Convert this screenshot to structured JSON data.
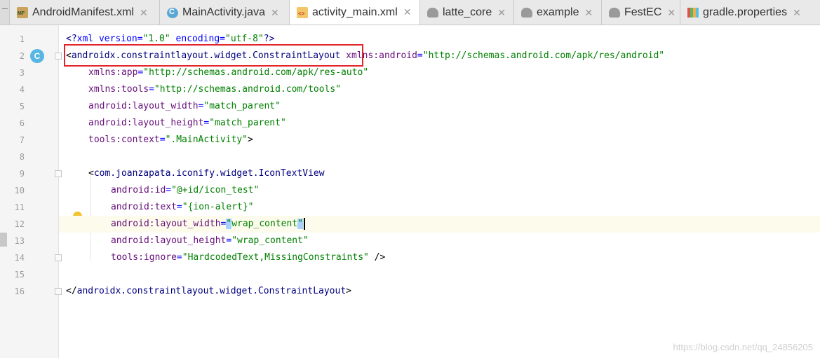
{
  "tabs": [
    {
      "label": "AndroidManifest.xml",
      "icon": "manifest-file-icon",
      "active": false
    },
    {
      "label": "MainActivity.java",
      "icon": "java-class-icon",
      "active": false
    },
    {
      "label": "activity_main.xml",
      "icon": "xml-layout-icon",
      "active": true
    },
    {
      "label": "latte_core",
      "icon": "gradle-module-icon",
      "active": false
    },
    {
      "label": "example",
      "icon": "gradle-module-icon",
      "active": false
    },
    {
      "label": "FestEC",
      "icon": "gradle-module-icon",
      "active": false
    },
    {
      "label": "gradle.properties",
      "icon": "properties-file-icon",
      "active": false
    }
  ],
  "close_glyph": "✕",
  "gutter": {
    "line_numbers": [
      "1",
      "2",
      "3",
      "4",
      "5",
      "6",
      "7",
      "8",
      "9",
      "10",
      "11",
      "12",
      "13",
      "14",
      "15",
      "16"
    ],
    "class_badge": "C"
  },
  "code": {
    "l1": [
      "<?",
      "xml version=",
      "\"1.0\"",
      " encoding=",
      "\"utf-8\"",
      "?>"
    ],
    "l2": [
      "<",
      "androidx.constraintlayout.widget.ConstraintLayout",
      " ",
      "xmlns:android",
      "=",
      "\"http://schemas.android.com/apk/res/android\""
    ],
    "l3": [
      "xmlns:app",
      "=",
      "\"http://schemas.android.com/apk/res-auto\""
    ],
    "l4": [
      "xmlns:tools",
      "=",
      "\"http://schemas.android.com/tools\""
    ],
    "l5": [
      "android:layout_width",
      "=",
      "\"match_parent\""
    ],
    "l6": [
      "android:layout_height",
      "=",
      "\"match_parent\""
    ],
    "l7": [
      "tools:context",
      "=",
      "\".MainActivity\"",
      ">"
    ],
    "l9": [
      "<",
      "com.joanzapata.iconify.widget.IconTextView"
    ],
    "l10": [
      "android:id",
      "=",
      "\"@+id/icon_test\""
    ],
    "l11": [
      "android:text",
      "=",
      "\"{ion-alert}\""
    ],
    "l12": [
      "android:layout_width",
      "=",
      "\"",
      "wrap_content",
      "\""
    ],
    "l13": [
      "android:layout_height",
      "=",
      "\"wrap_content\""
    ],
    "l14": [
      "tools:ignore",
      "=",
      "\"HardcodedText,MissingConstraints\"",
      " />"
    ],
    "l16": [
      "</",
      "androidx.constraintlayout.widget.ConstraintLayout",
      ">"
    ]
  },
  "watermark": "https://blog.csdn.net/qq_24856205"
}
